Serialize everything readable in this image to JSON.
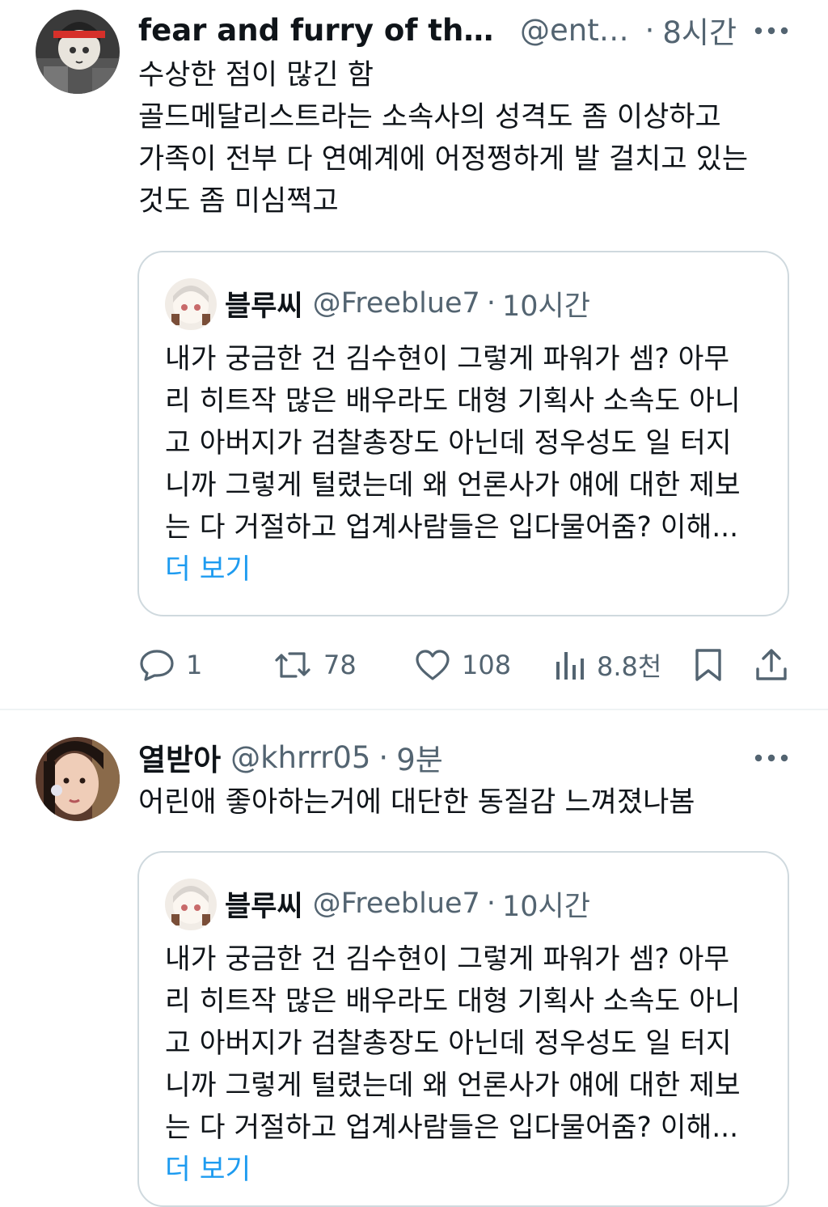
{
  "tweets": [
    {
      "display_name": "fear and furry of the nu...",
      "handle": "@ente...",
      "time": "8시간",
      "text_lines": [
        "수상한 점이 많긴 함",
        "골드메달리스트라는 소속사의 성격도 좀 이상하고",
        "가족이 전부 다 연예계에 어정쩡하게 발 걸치고 있는",
        "것도 좀 미심쩍고"
      ],
      "quote": {
        "display_name": "블루씨",
        "handle": "@Freeblue7",
        "time": "10시간",
        "text_lines": [
          "내가 궁금한 건 김수현이 그렇게 파워가 셈? 아무",
          "리 히트작 많은 배우라도 대형 기획사 소속도 아니",
          "고 아버지가 검찰총장도 아닌데 정우성도 일 터지",
          "니까 그렇게 털렸는데 왜 언론사가 얘에 대한 제보",
          "는 다 거절하고 업계사람들은 입다물어줌? 이해..."
        ],
        "show_more": "더 보기"
      },
      "actions": {
        "replies": "1",
        "retweets": "78",
        "likes": "108",
        "views": "8.8천"
      }
    },
    {
      "display_name": "열받아",
      "handle": "@khrrr05",
      "time": "9분",
      "text_lines": [
        "어린애 좋아하는거에 대단한 동질감 느껴졌나봄"
      ],
      "quote": {
        "display_name": "블루씨",
        "handle": "@Freeblue7",
        "time": "10시간",
        "text_lines": [
          "내가 궁금한 건 김수현이 그렇게 파워가 셈? 아무",
          "리 히트작 많은 배우라도 대형 기획사 소속도 아니",
          "고 아버지가 검찰총장도 아닌데 정우성도 일 터지",
          "니까 그렇게 털렸는데 왜 언론사가 얘에 대한 제보",
          "는 다 거절하고 업계사람들은 입다물어줌? 이해..."
        ],
        "show_more": "더 보기"
      }
    }
  ],
  "icons": {
    "more": "more-horizontal-icon",
    "reply": "reply-bubble-icon",
    "retweet": "retweet-icon",
    "like": "heart-icon",
    "views": "views-bar-chart-icon",
    "bookmark": "bookmark-icon",
    "share": "share-upload-icon"
  },
  "colors": {
    "text_primary": "#0f1419",
    "text_secondary": "#536471",
    "link": "#1d9bf0",
    "border": "#cfd9de"
  }
}
